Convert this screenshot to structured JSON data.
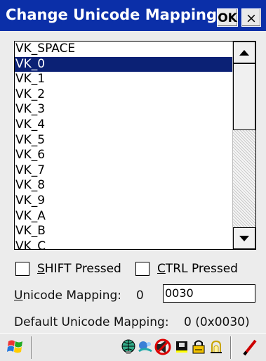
{
  "window": {
    "title": "Change Unicode Mapping",
    "ok_label": "OK",
    "close_label": "×"
  },
  "list": {
    "items": [
      "VK_SPACE",
      "VK_0",
      "VK_1",
      "VK_2",
      "VK_3",
      "VK_4",
      "VK_5",
      "VK_6",
      "VK_7",
      "VK_8",
      "VK_9",
      "VK_A",
      "VK_B",
      "VK_C"
    ],
    "selected": "VK_0"
  },
  "options": {
    "shift": {
      "prefix": "",
      "accel": "S",
      "rest": "HIFT Pressed",
      "checked": false
    },
    "ctrl": {
      "prefix": "",
      "accel": "C",
      "rest": "TRL Pressed",
      "checked": false
    }
  },
  "mapping": {
    "label_accel": "U",
    "label_rest": "nicode Mapping:",
    "value": "0",
    "input_value": "0030",
    "default_label": "Default Unicode Mapping:",
    "default_value": "0 (0x0030)"
  },
  "taskbar": {
    "icons": [
      "start-flag-icon",
      "network-globe-icon",
      "connection-icon",
      "speaker-muted-icon",
      "battery-card-icon",
      "keyboard-lock-icon",
      "radio-icon",
      "stylus-icon"
    ]
  },
  "colors": {
    "titlebar": "#0b2fa8",
    "selection": "#0b2175",
    "background": "#ececec"
  }
}
